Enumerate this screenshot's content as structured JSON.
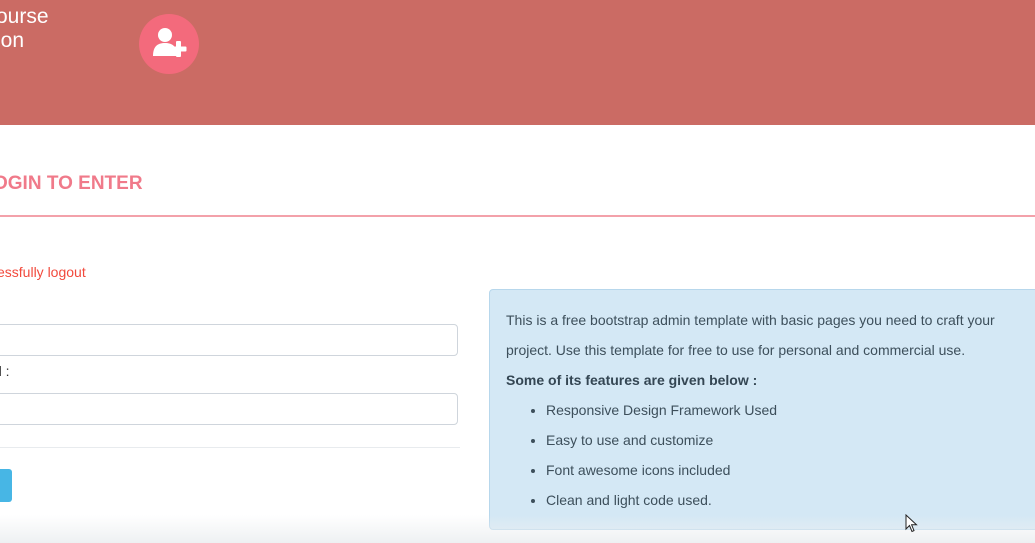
{
  "header": {
    "brand_line1": "ourse",
    "brand_line2": "ion",
    "logo_icon": "add-user-icon",
    "background_color": "#cb6b64",
    "logo_color": "#f36a7c"
  },
  "page_heading": "OGIN TO ENTER",
  "status_message": "essfully logout",
  "form": {
    "username_value": "",
    "password_label": "d :",
    "password_value": "",
    "submit_label": ""
  },
  "info_box": {
    "text": "This is a free bootstrap admin template with basic pages you need to craft your project. Use this template for free to use for personal and commercial use.",
    "features_heading": "Some of its features are given below :",
    "features": [
      "Responsive Design Framework Used",
      "Easy to use and customize",
      "Font awesome icons included",
      "Clean and light code used."
    ]
  },
  "colors": {
    "accent_pink": "#f07a8a",
    "message_red": "#f24a3d",
    "button_blue": "#47b6e5",
    "info_bg": "#d4e8f5"
  }
}
